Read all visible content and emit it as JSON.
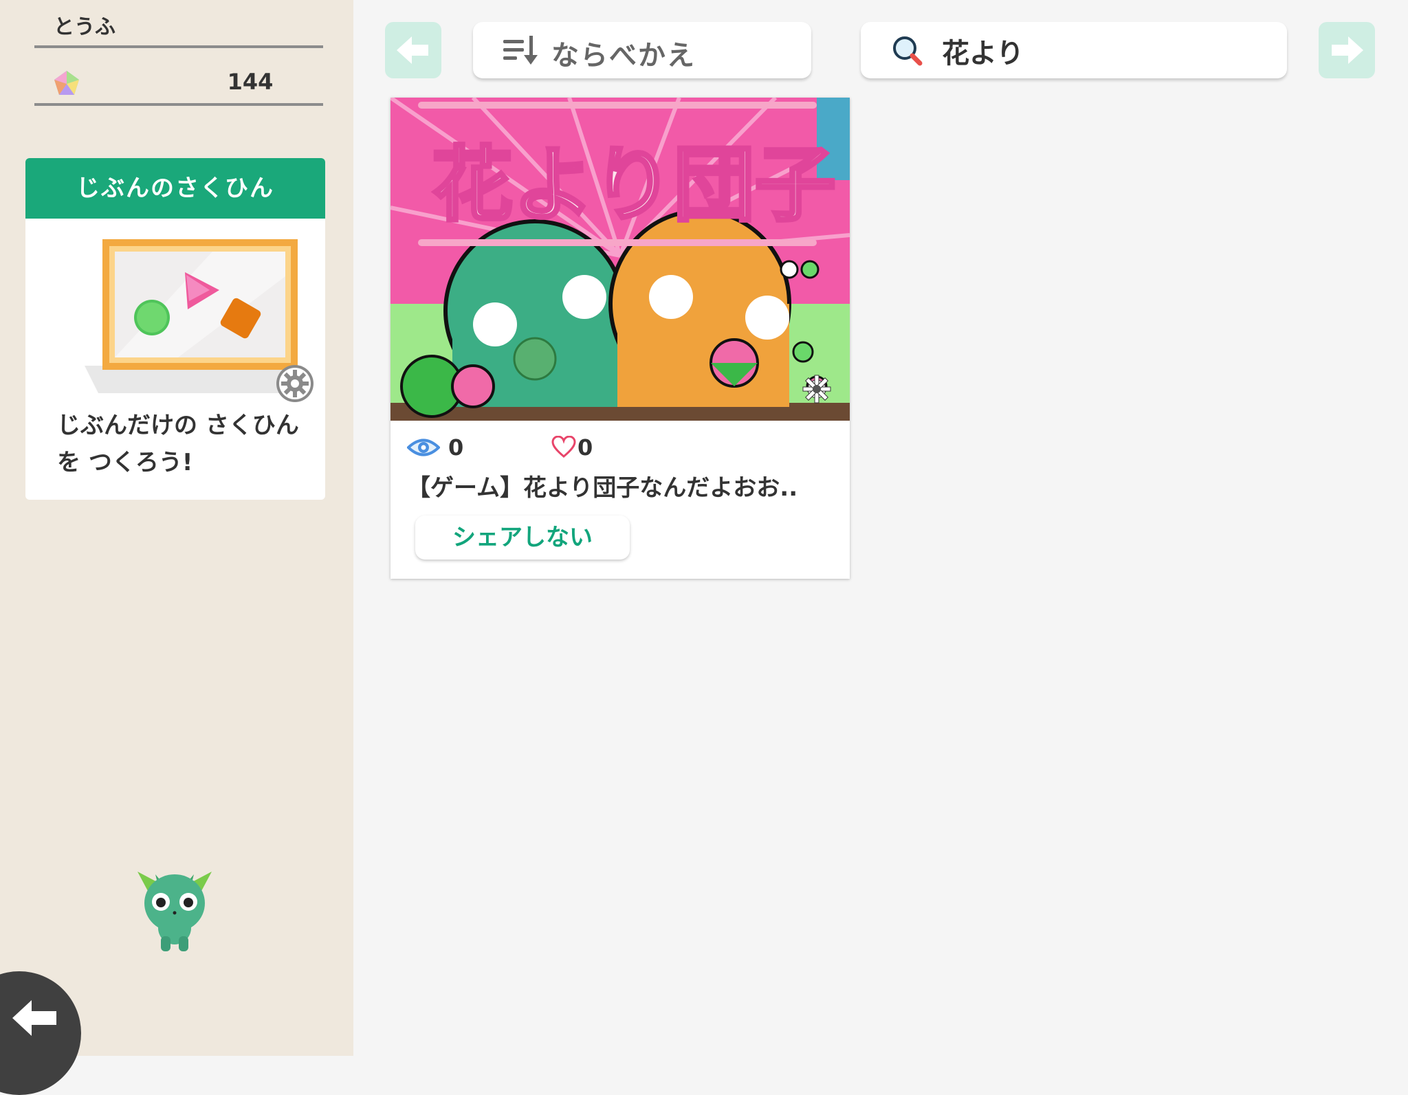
{
  "user": {
    "name": "とうふ",
    "points": "144",
    "gem_icon": "rainbow-gem-icon"
  },
  "own_works": {
    "title": "じぶんのさくひん",
    "message": "じぶんだけの さくひんを つくろう!",
    "icons": [
      "picture-frame-icon",
      "gear-icon"
    ]
  },
  "toolbar": {
    "sort_label": "ならべかえ",
    "search_value": "花より",
    "icons": [
      "arrow-left-icon",
      "sort-icon",
      "search-icon",
      "arrow-right-icon"
    ]
  },
  "works": [
    {
      "thumbnail_text": "花より団子",
      "views": "0",
      "likes": "0",
      "title": "【ゲーム】花より団子なんだよおお..",
      "share_label": "シェアしない"
    }
  ],
  "colors": {
    "accent": "#1aa87a",
    "sidebar_bg": "#efe8dd",
    "main_bg": "#f5f5f5",
    "disabled_arrow": "#cfeee3"
  }
}
